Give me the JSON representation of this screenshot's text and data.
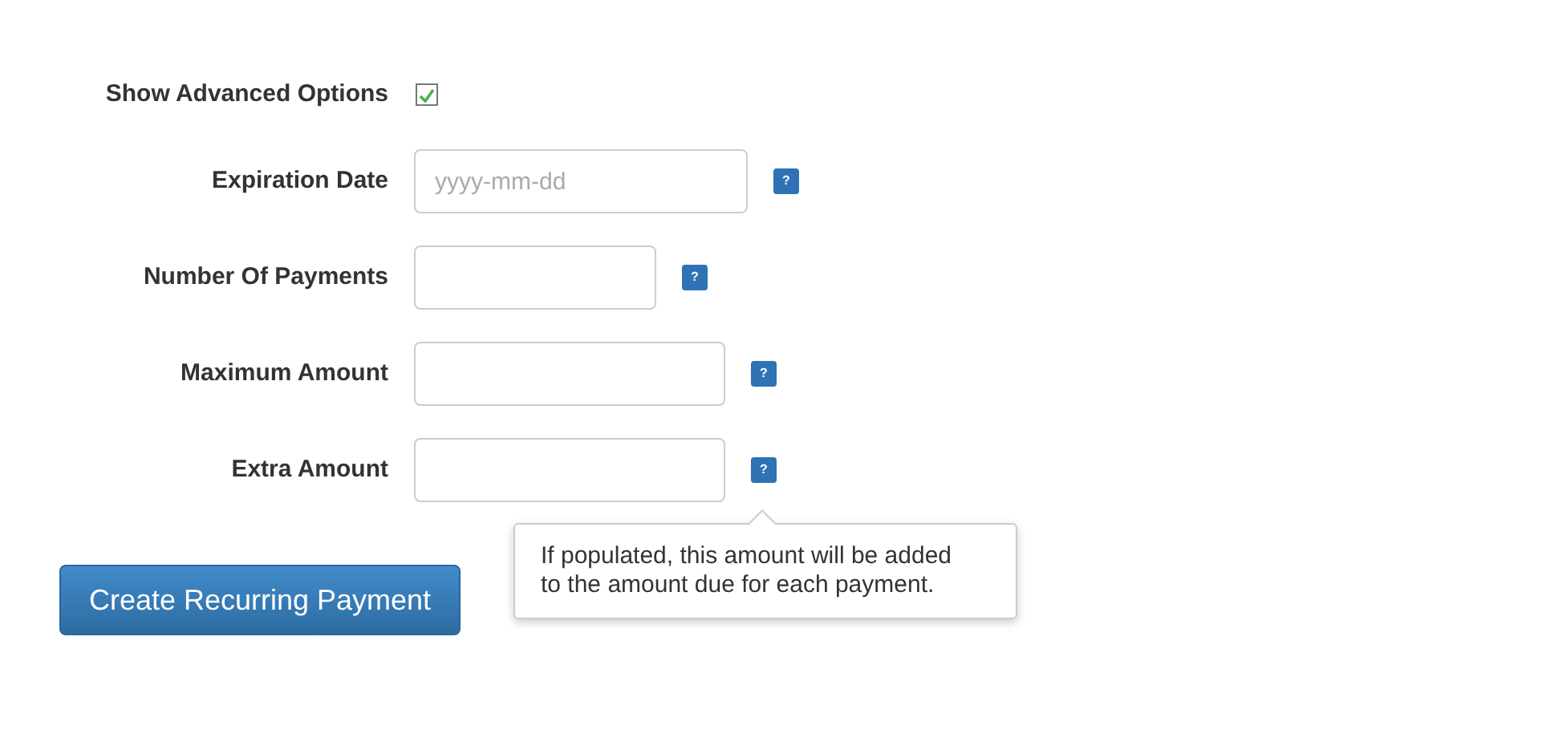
{
  "advanced": {
    "label": "Show Advanced Options",
    "checked": true
  },
  "fields": [
    {
      "label": "Expiration Date",
      "placeholder": "yyyy-mm-dd",
      "help": "?"
    },
    {
      "label": "Number Of Payments",
      "help": "?"
    },
    {
      "label": "Maximum Amount",
      "help": "?"
    },
    {
      "label": "Extra Amount",
      "help": "?",
      "tooltip": "If populated, this amount will be added to the amount due for each payment."
    }
  ],
  "submit": "Create Recurring Payment"
}
